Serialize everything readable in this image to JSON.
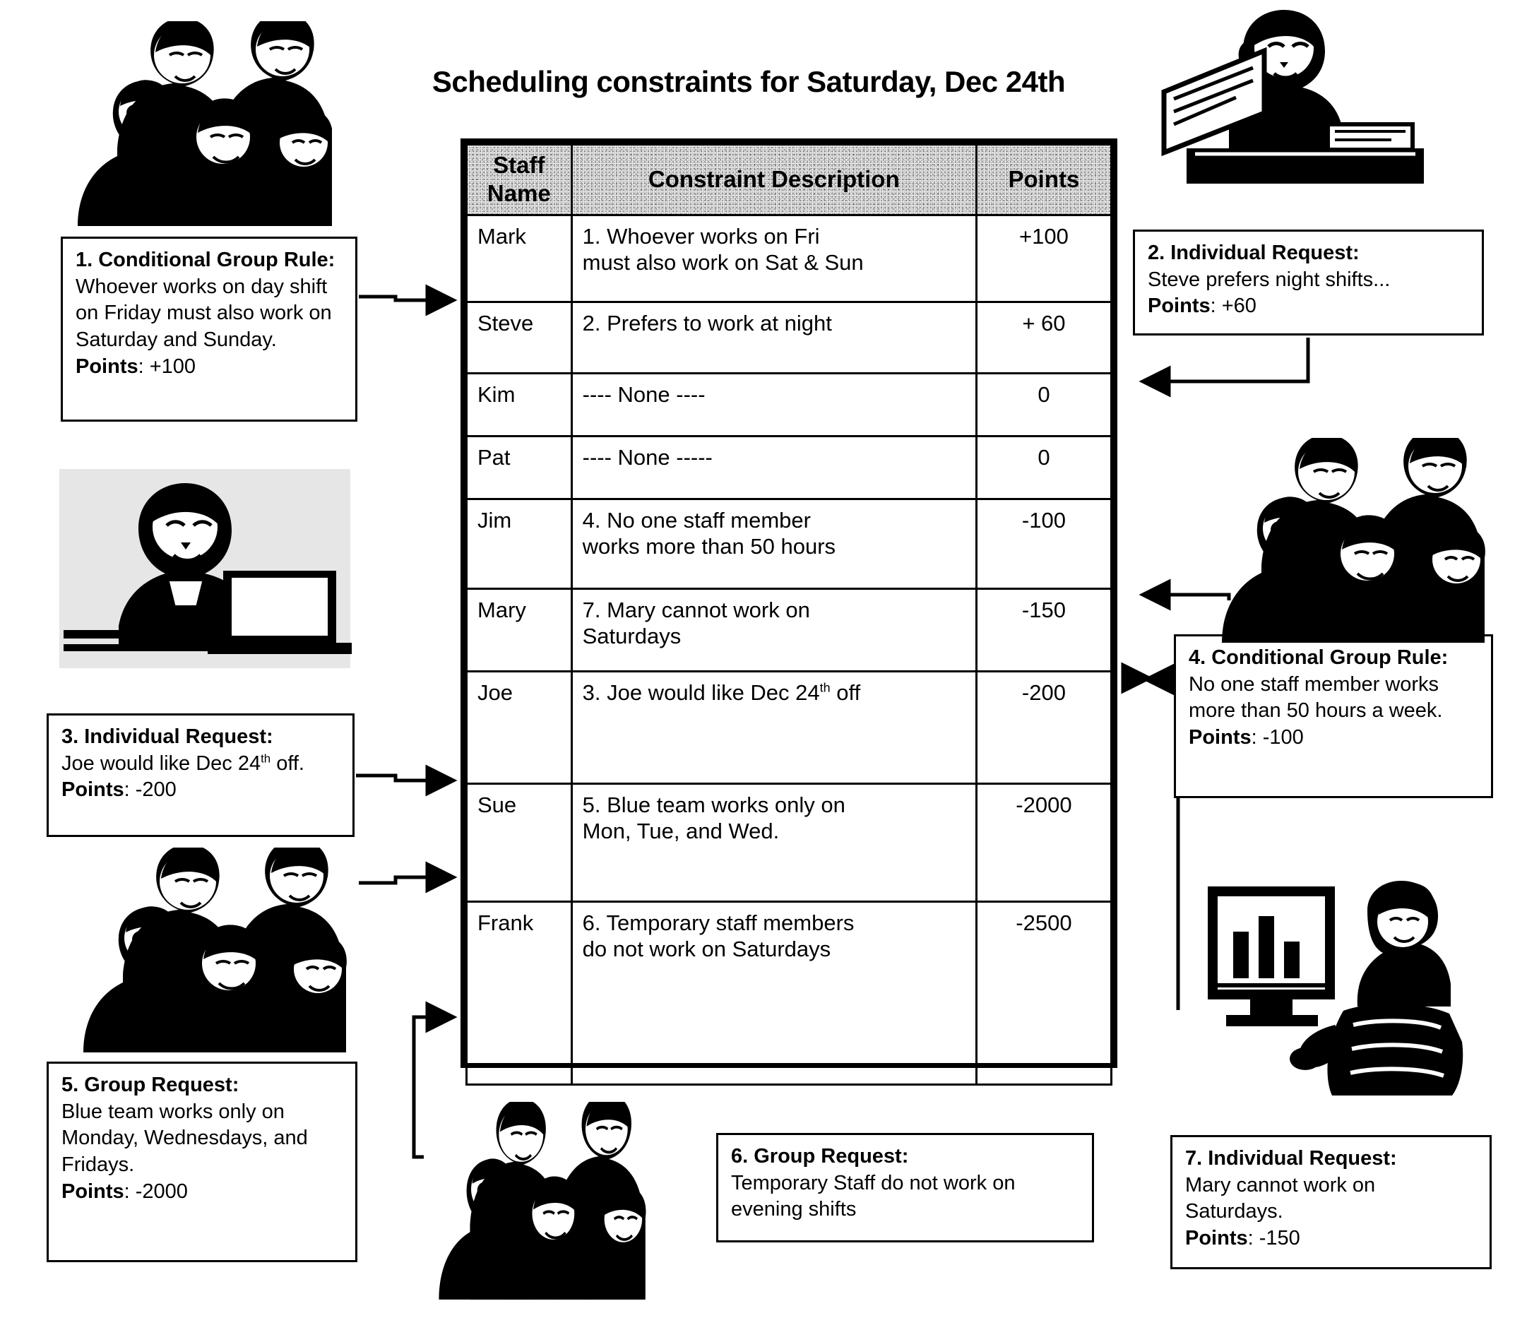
{
  "page": {
    "title": "Scheduling constraints for Saturday, Dec 24th"
  },
  "table": {
    "headers": {
      "name": "Staff\nName",
      "name_line1": "Staff",
      "name_line2": "Name",
      "description": "Constraint Description",
      "points": "Points"
    },
    "rows": [
      {
        "name": "Mark",
        "desc_line1": "1. Whoever works on Fri",
        "desc_line2": "must also work on Sat & Sun",
        "points": "+100"
      },
      {
        "name": "Steve",
        "desc_line1": "2. Prefers to work at night",
        "desc_line2": "",
        "points": "+ 60"
      },
      {
        "name": "Kim",
        "desc_line1": "---- None ----",
        "desc_line2": "",
        "points": "0"
      },
      {
        "name": "Pat",
        "desc_line1": "---- None -----",
        "desc_line2": "",
        "points": "0"
      },
      {
        "name": "Jim",
        "desc_line1": "4. No one staff member",
        "desc_line2": "works more than 50 hours",
        "points": "-100"
      },
      {
        "name": "Mary",
        "desc_line1": "7. Mary cannot work on",
        "desc_line2": "Saturdays",
        "points": "-150"
      },
      {
        "name": "Joe",
        "desc_line1": "3. Joe would like Dec 24",
        "desc_sup": "th",
        "desc_line1_tail": " off",
        "desc_line2": "",
        "points": "-200"
      },
      {
        "name": "Sue",
        "desc_line1": "5. Blue team works only on",
        "desc_line2": "Mon, Tue, and Wed.",
        "points": "-2000"
      },
      {
        "name": "Frank",
        "desc_line1": "6. Temporary staff members",
        "desc_line2": "do not work on Saturdays",
        "points": "-2500"
      }
    ]
  },
  "callouts": {
    "c1": {
      "heading": "1. Conditional Group",
      "rule_label": "Rule:",
      "body": "Whoever works on day shift on Friday must also work on Saturday and Sunday.",
      "points_label": "Points",
      "points_value": ": +100"
    },
    "c2": {
      "heading": "2. Individual Request:",
      "body": "Steve prefers night shifts...",
      "points_label": "Points",
      "points_value": ": +60"
    },
    "c3": {
      "heading": "3. Individual Request:",
      "body_pre": "Joe would like Dec 24",
      "body_sup": "th",
      "body_post": " off.",
      "points_label": "Points",
      "points_value": ": -200"
    },
    "c4": {
      "heading": "4. Conditional Group",
      "rule_label": "Rule:",
      "body": "No one staff member works more than 50 hours a week.",
      "points_label": "Points",
      "points_value": ": -100"
    },
    "c5": {
      "heading": "5. Group Request:",
      "body": "Blue team works only on Monday, Wednesdays, and Fridays.",
      "points_label": "Points",
      "points_value": ": -2000"
    },
    "c6": {
      "heading": "6. Group Request:",
      "body": "Temporary Staff do not work on evening shifts"
    },
    "c7": {
      "heading": "7. Individual Request:",
      "body": "Mary cannot work on Saturdays.",
      "points_label": "Points",
      "points_value": ": -150"
    }
  },
  "colors": {
    "ink": "#000000",
    "paper": "#ffffff",
    "header_fill": "#e8e8e8"
  },
  "clipart": [
    {
      "name": "group-of-five-people-top-left"
    },
    {
      "name": "man-at-desk-with-headset"
    },
    {
      "name": "man-working-on-laptop"
    },
    {
      "name": "group-of-five-people-right"
    },
    {
      "name": "group-of-five-people-bottom-left"
    },
    {
      "name": "woman-at-computer"
    },
    {
      "name": "group-of-five-people-bottom-middle"
    }
  ]
}
